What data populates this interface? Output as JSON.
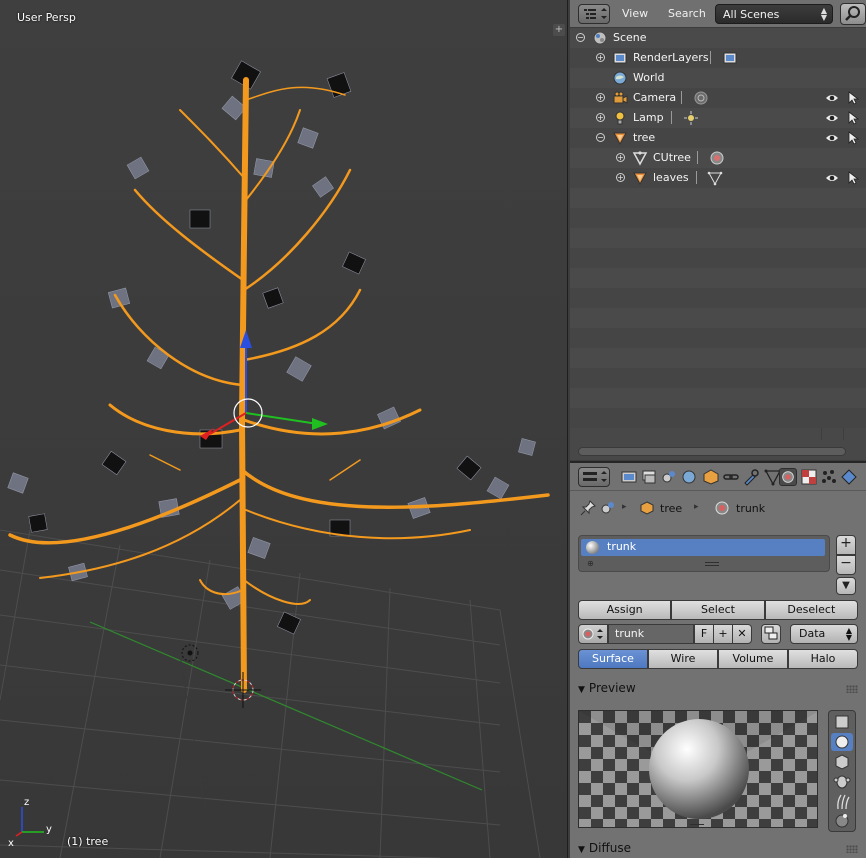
{
  "viewport": {
    "view_label": "User Persp",
    "object_label": "(1) tree",
    "axes": {
      "x": "x",
      "y": "y",
      "z": "z"
    }
  },
  "outliner": {
    "header": {
      "menu_view": "View",
      "menu_search": "Search",
      "scene_filter": "All Scenes"
    },
    "items": [
      {
        "label": "Scene",
        "icon": "scene-icon"
      },
      {
        "label": "RenderLayers",
        "icon": "render-layers-icon"
      },
      {
        "label": "World",
        "icon": "world-icon"
      },
      {
        "label": "Camera",
        "icon": "camera-icon"
      },
      {
        "label": "Lamp",
        "icon": "lamp-icon"
      },
      {
        "label": "tree",
        "icon": "mesh-icon"
      },
      {
        "label": "CUtree",
        "icon": "curve-icon"
      },
      {
        "label": "leaves",
        "icon": "mesh-icon"
      }
    ]
  },
  "properties": {
    "breadcrumb": {
      "object": "tree",
      "material": "trunk"
    },
    "material_slot": "trunk",
    "slot_buttons": {
      "assign": "Assign",
      "select": "Select",
      "deselect": "Deselect"
    },
    "material_name": "trunk",
    "fake_user": "F",
    "link": "Data",
    "tabs": [
      "Surface",
      "Wire",
      "Volume",
      "Halo"
    ],
    "active_tab": "Surface",
    "panels": {
      "preview": "Preview",
      "diffuse": "Diffuse"
    }
  },
  "colors": {
    "selection_orange": "#f39a1e",
    "accent_blue": "#5680c2",
    "axis_red": "#e02020",
    "axis_green": "#20c020",
    "axis_blue": "#2a4fe0"
  }
}
